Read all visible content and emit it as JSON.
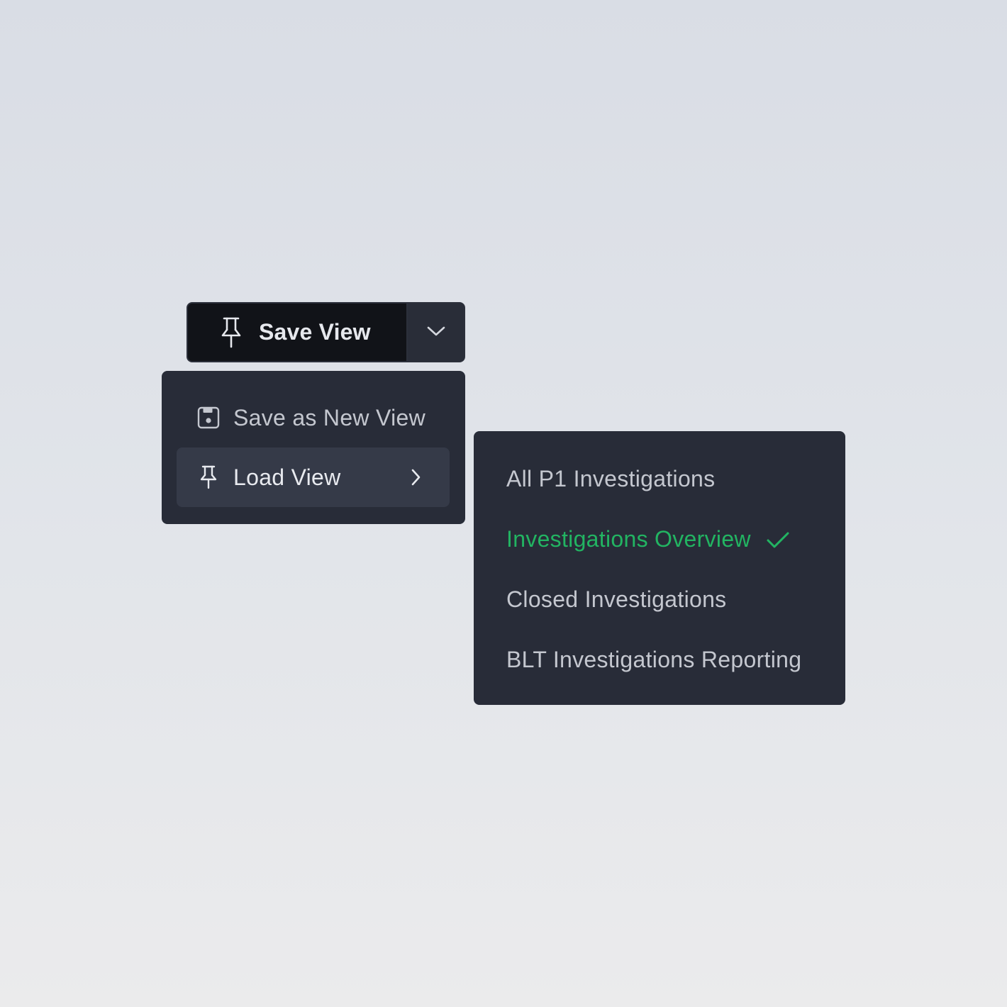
{
  "save_view_button": {
    "label": "Save View",
    "icon": "pin-icon"
  },
  "dropdown_toggle": {
    "icon": "chevron-down-icon"
  },
  "menu": {
    "items": [
      {
        "label": "Save as New View",
        "icon": "save-icon",
        "active": false
      },
      {
        "label": "Load View",
        "icon": "pin-icon",
        "active": true,
        "has_submenu": true
      }
    ]
  },
  "submenu": {
    "items": [
      {
        "label": "All P1 Investigations",
        "selected": false
      },
      {
        "label": "Investigations Overview",
        "selected": true,
        "icon": "check-icon"
      },
      {
        "label": "Closed Investigations",
        "selected": false
      },
      {
        "label": "BLT Investigations Reporting",
        "selected": false
      }
    ]
  },
  "colors": {
    "selected_accent": "#22b462",
    "menu_background": "#282c38",
    "button_background": "#111318"
  }
}
